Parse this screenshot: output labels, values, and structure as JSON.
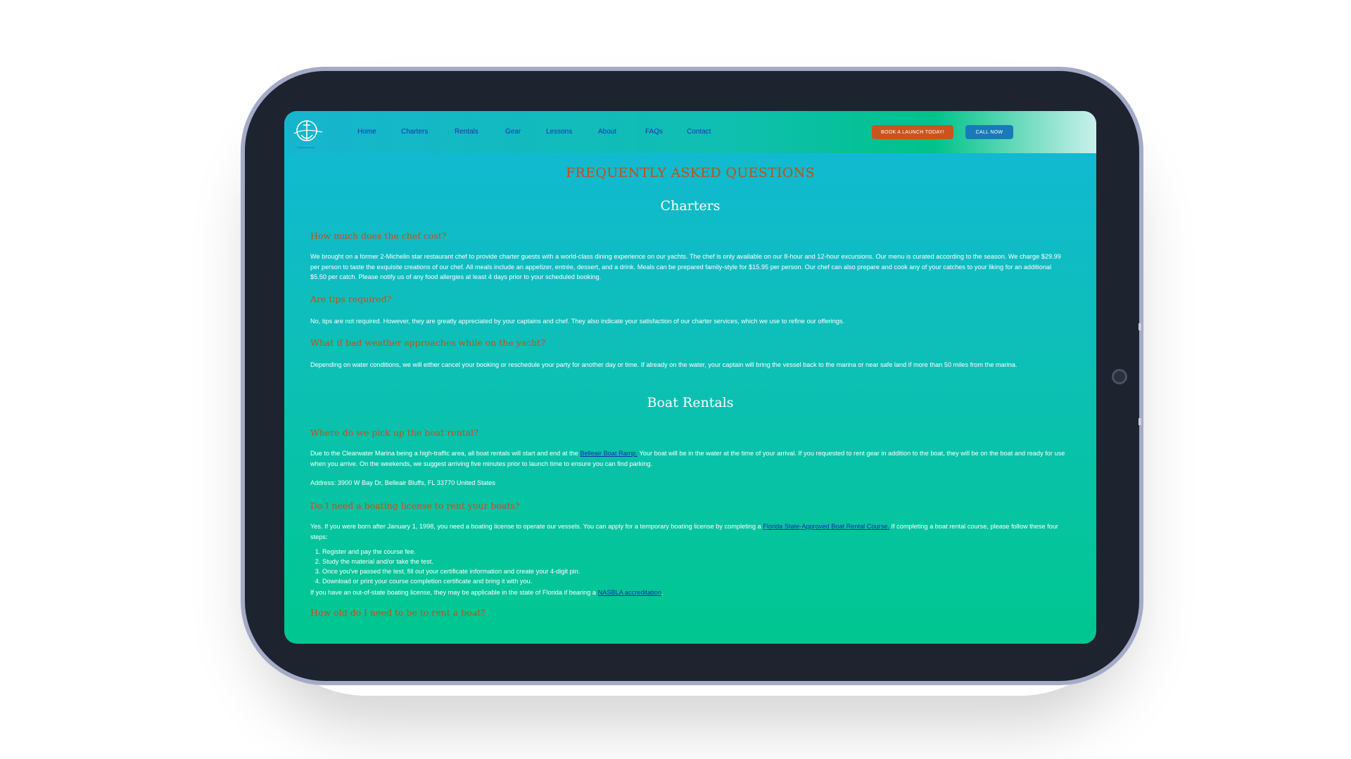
{
  "nav": {
    "links": [
      "Home",
      "Charters",
      "Rentals",
      "Gear",
      "Lessons",
      "About",
      "FAQs",
      "Contact"
    ],
    "book_label": "BOOK A LAUNCH TODAY!",
    "call_label": "CALL NOW"
  },
  "page": {
    "title": "FREQUENTLY ASKED QUESTIONS"
  },
  "charters": {
    "heading": "Charters",
    "q1": "How much does the chef cost?",
    "a1": "We brought on a former 2-Michelin star restaurant chef to provide charter guests with a world-class dining experience on our yachts. The chef is only available on our 8-hour and 12-hour excursions. Our menu is curated according to the season. We charge $29.99 per person to taste the exquisite creations of our chef. All meals include an appetizer, entrée, dessert, and a drink. Meals can be prepared family-style for $15.95 per person. Our chef can also prepare and cook any of your catches to your liking for an additional $5.50 per catch. Please notify us of any food allergies at least 4 days prior to your scheduled booking.",
    "q2": "Are tips required?",
    "a2": "No, tips are not required. However, they are greatly appreciated by your captains and chef. They also indicate your satisfaction of our charter services, which we use to refine our offerings.",
    "q3": "What if bad weather approaches while on the yacht?",
    "a3": "Depending on water conditions, we will either cancel your booking or reschedule your party for another day or time. If already on the water, your captain will bring the vessel back to the marina or near safe land if more than 50 miles from the marina."
  },
  "rentals": {
    "heading": "Boat Rentals",
    "q1": "Where do we pick up the boat rental?",
    "a1_pre": "Due to the Clearwater Marina being a high-traffic area, all boat rentals will start and end at the ",
    "a1_link": "Belleair Boat Ramp.",
    "a1_post": " Your boat will be in the water at the time of your arrival. If you requested to rent gear in addition to the boat, they will be on the boat and ready for use when you arrive. On the weekends, we suggest arriving five minutes prior to launch time to ensure you can find parking.",
    "address": "Address: 3900 W Bay Dr, Belleair Bluffs, FL 33770 United States",
    "q2": "Do I need a boating license to rent your boats?",
    "a2_pre": "Yes. If you were born after January 1, 1998, you need a boating license to operate our vessels. You can apply for a temporary boating license by completing a ",
    "a2_link": "Florida State-Approved Boat Rental Course.",
    "a2_post": " If completing a boat rental course, please follow these four steps:",
    "steps": [
      "Register and pay the course fee.",
      "Study the material and/or take the test.",
      "Once you've passed the test, fill out your certificate information and create your 4-digit pin.",
      "Download or print your course completion certificate and bring it with you."
    ],
    "a2b_pre": "If you have an out-of-state boating license, they may be applicable in the state of Florida if bearing a ",
    "a2b_link": "NASBLA accreditation",
    "a2b_post": ".",
    "q3": "How old do I need to be to rent a boat?"
  },
  "icons": {
    "logo": "anchor-logo-icon",
    "camera": "camera-icon"
  }
}
